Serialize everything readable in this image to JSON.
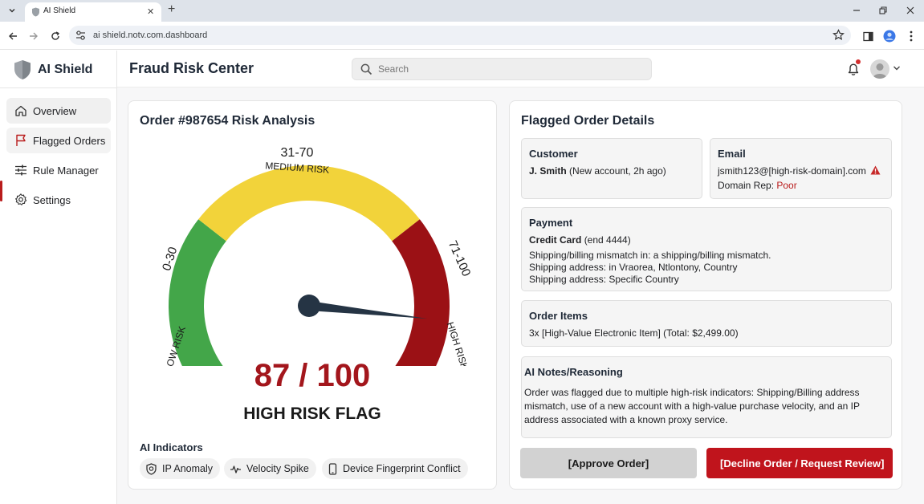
{
  "browser": {
    "tab_title": "AI Shield",
    "url": "ai shield.notv.com.dashboard"
  },
  "app": {
    "brand": "AI Shield",
    "page_title": "Fraud Risk Center",
    "search": {
      "placeholder": "Search"
    }
  },
  "sidebar": {
    "items": [
      {
        "label": "Overview",
        "icon": "home-icon"
      },
      {
        "label": "Flagged Orders",
        "icon": "flag-icon"
      },
      {
        "label": "Rule Manager",
        "icon": "sliders-icon"
      },
      {
        "label": "Settings",
        "icon": "gear-icon"
      }
    ]
  },
  "risk": {
    "title": "Order #987654 Risk Analysis",
    "score_text": "87 / 100",
    "score": 87,
    "max": 100,
    "flag": "HIGH RISK FLAG",
    "gauge": {
      "low_range": "0-30",
      "low_label": "LOW RISK",
      "medium_range": "31-70",
      "medium_label": "MEDIUM RISK",
      "high_range": "71-100",
      "high_label": "HIGH RISK",
      "colors": {
        "low": "#43a649",
        "medium": "#f2d33a",
        "high": "#9b1115",
        "needle": "#253444"
      }
    },
    "indicators_label": "AI Indicators",
    "indicators": [
      {
        "label": "IP Anomaly",
        "icon": "shield-icon"
      },
      {
        "label": "Velocity Spike",
        "icon": "activity-icon"
      },
      {
        "label": "Device Fingerprint Conflict",
        "icon": "phone-icon"
      }
    ]
  },
  "details": {
    "title": "Flagged Order Details",
    "customer": {
      "heading": "Customer",
      "name": "J. Smith",
      "note": "(New account, 2h ago)"
    },
    "email": {
      "heading": "Email",
      "address": "jsmith123@[high-risk-domain].com",
      "rep_label": "Domain Rep:",
      "rep_value": "Poor"
    },
    "payment": {
      "heading": "Payment",
      "method": "Credit Card",
      "method_note": "(end 4444)",
      "line1": "Shipping/billing mismatch in: a shipping/billing mismatch.",
      "line2": "Shipping address: in Vraorea, Ntlontony, Country",
      "line3": "Shipping address: Specific Country"
    },
    "items": {
      "heading": "Order Items",
      "line": "3x [High-Value Electronic Item] (Total: $2,499.00)"
    },
    "notes": {
      "heading": "AI Notes/Reasoning",
      "body": "Order was flagged due to multiple high-risk indicators: Shipping/Billing address mismatch, use of a new account with a high-value purchase velocity, and an IP address associated with a known proxy service."
    },
    "approve_label": "[Approve Order]",
    "decline_label": "[Decline Order / Request Review]"
  }
}
